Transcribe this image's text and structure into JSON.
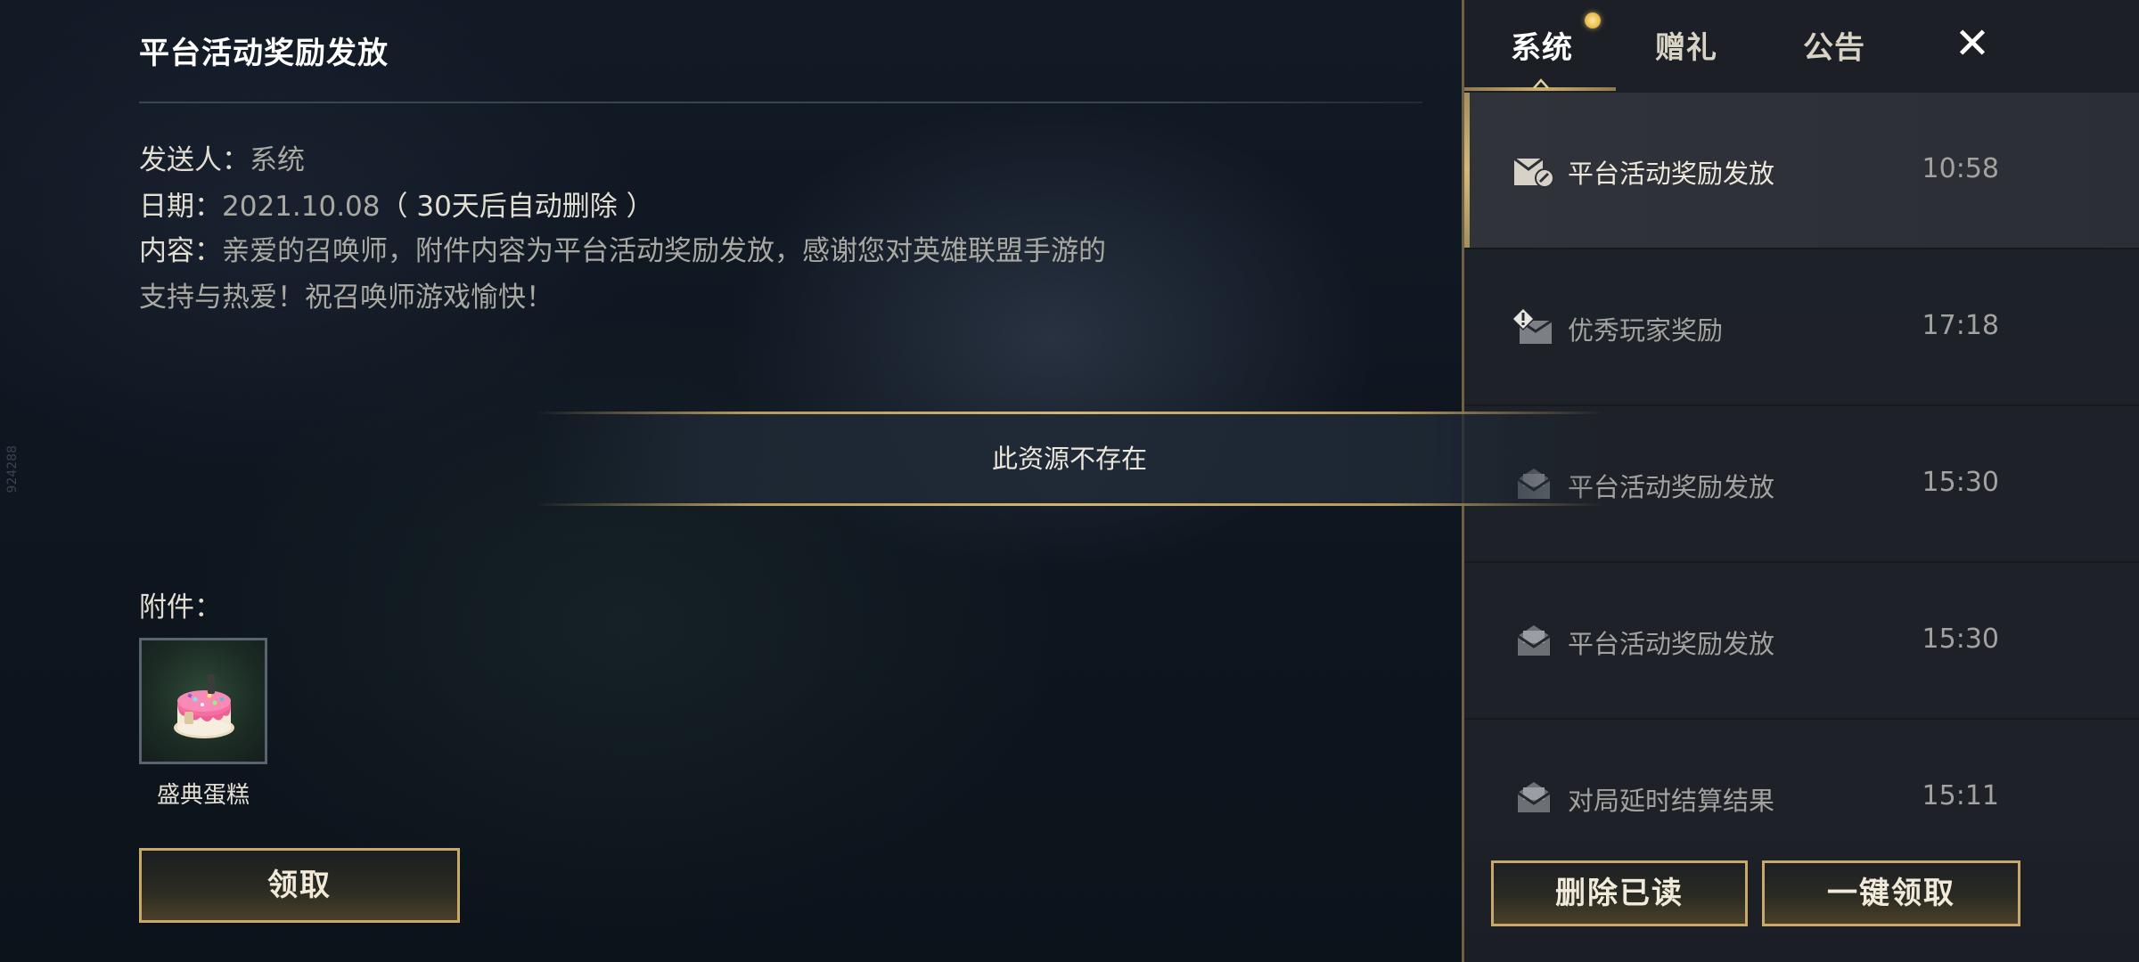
{
  "detail": {
    "title": "平台活动奖励发放",
    "sender_label": "发送人：",
    "sender_value": "系统",
    "date_label": "日期：",
    "date_value": "2021.10.08",
    "date_note": "（ 30天后自动删除 ）",
    "content_label": "内容：",
    "content_value": "亲爱的召唤师，附件内容为平台活动奖励发放，感谢您对英雄联盟手游的支持与热爱！祝召唤师游戏愉快！",
    "attachment_label": "附件：",
    "attachment_item_name": "盛典蛋糕",
    "claim_button": "领取"
  },
  "toast": {
    "message": "此资源不存在"
  },
  "side_mark": "924288",
  "mailbox": {
    "tabs": [
      {
        "label": "系统",
        "active": true,
        "has_dot": true
      },
      {
        "label": "赠礼",
        "active": false
      },
      {
        "label": "公告",
        "active": false
      }
    ],
    "close_icon": "close-icon",
    "mails": [
      {
        "subject": "平台活动奖励发放",
        "time": "10:58",
        "icon": "mail-reward-icon",
        "selected": true
      },
      {
        "subject": "优秀玩家奖励",
        "time": "17:18",
        "icon": "mail-alert-icon",
        "selected": false
      },
      {
        "subject": "平台活动奖励发放",
        "time": "15:30",
        "icon": "mail-open-icon",
        "selected": false
      },
      {
        "subject": "平台活动奖励发放",
        "time": "15:30",
        "icon": "mail-open-icon",
        "selected": false
      },
      {
        "subject": "对局延时结算结果",
        "time": "15:11",
        "icon": "mail-open-icon",
        "selected": false
      }
    ],
    "delete_read_button": "删除已读",
    "claim_all_button": "一键领取"
  },
  "colors": {
    "gold_accent": "#c8a96a",
    "panel_bg": "#1e2228",
    "selected_row_bg": "#30343a",
    "muted_text": "#a2a29e",
    "notification_dot": "#e9bd52"
  }
}
